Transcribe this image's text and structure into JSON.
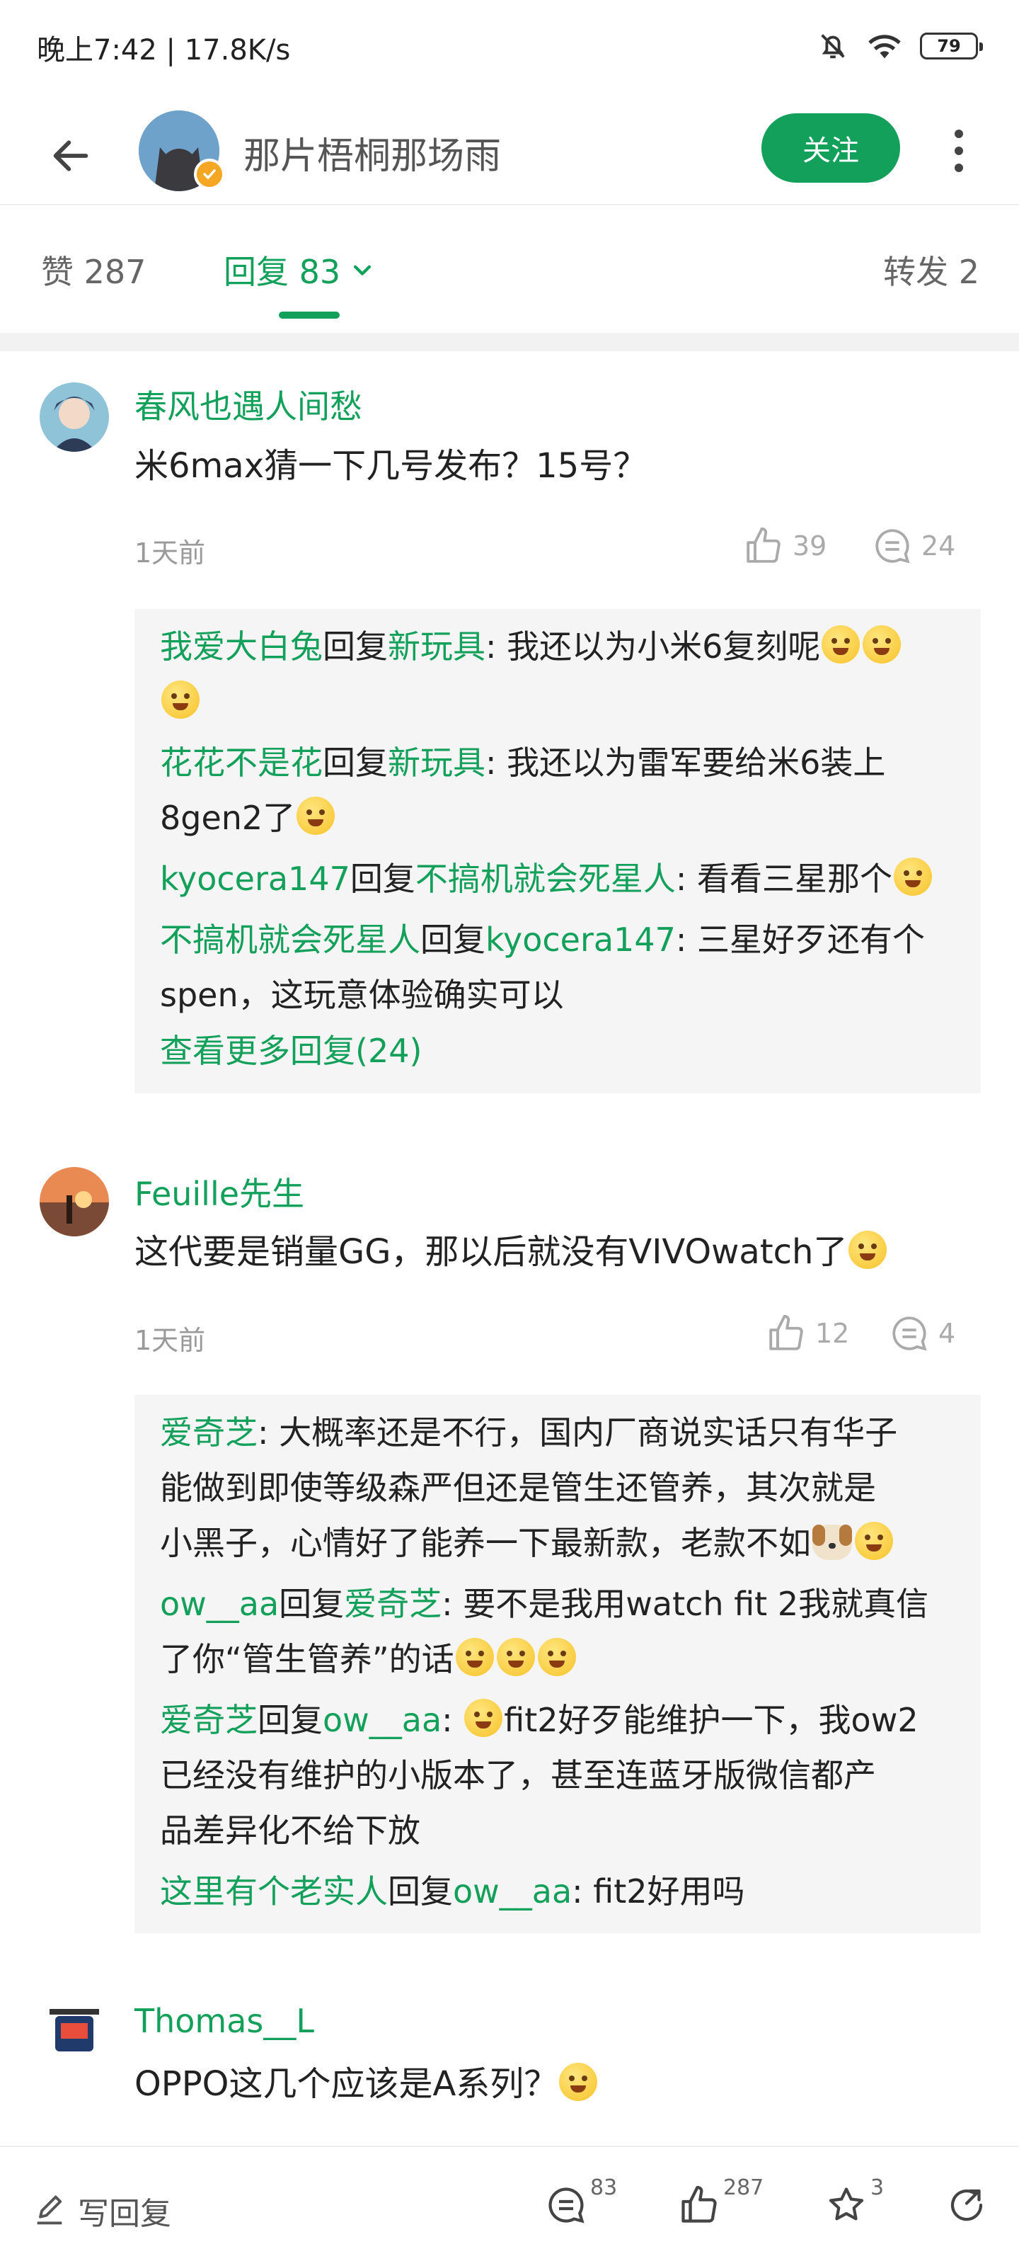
{
  "status": {
    "time_speed": "晚上7:42 | 17.8K/s",
    "battery": "79"
  },
  "header": {
    "title": "那片梧桐那场雨",
    "follow_label": "关注"
  },
  "tabs": {
    "likes": "赞 287",
    "replies": "回复 83",
    "forwards": "转发 2"
  },
  "comments": [
    {
      "author": "春风也遇人间愁",
      "text": "米6max猜一下几号发布？15号？",
      "time": "1天前",
      "likes": "39",
      "replies": "24",
      "sub_replies": [
        {
          "user": "我爱大白兔",
          "verb": "回复",
          "target": "新玩具",
          "text_1": ": 我还以为小米6复刻呢",
          "text_2": ""
        },
        {
          "user": "花花不是花",
          "verb": "回复",
          "target": "新玩具",
          "text_1": ": 我还以为雷军要给米6装上",
          "text_2": "8gen2了"
        },
        {
          "user": "kyocera147",
          "verb": "回复",
          "target": "不搞机就会死星人",
          "text_1": ": 看看三星那个",
          "text_2": ""
        },
        {
          "user": "不搞机就会死星人",
          "verb": "回复",
          "target": "kyocera147",
          "text_1": ": 三星好歹还有个",
          "text_2": "spen，这玩意体验确实可以"
        }
      ],
      "more_label": "查看更多回复(24)"
    },
    {
      "author": "Feuille先生",
      "text": "这代要是销量GG，那以后就没有VIVOwatch了",
      "time": "1天前",
      "likes": "12",
      "replies": "4",
      "sub_replies": [
        {
          "user": "爱奇芝",
          "verb": "",
          "target": "",
          "text_1": ": 大概率还是不行，国内厂商说实话只有华子",
          "text_2": "能做到即使等级森严但还是管生还管养，其次就是",
          "text_3": "小黑子，心情好了能养一下最新款，老款不如"
        },
        {
          "user": "ow__aa",
          "verb": "回复",
          "target": "爱奇芝",
          "text_1": ": 要不是我用watch fit 2我就真信",
          "text_2": "了你“管生管养”的话"
        },
        {
          "user": "爱奇芝",
          "verb": "回复",
          "target": "ow__aa",
          "text_1": ": ",
          "text_1b": "fit2好歹能维护一下，我ow2",
          "text_2": "已经没有维护的小版本了，甚至连蓝牙版微信都产",
          "text_3": "品差异化不给下放"
        },
        {
          "user": "这里有个老实人",
          "verb": "回复",
          "target": "ow__aa",
          "text_1": ": fit2好用吗"
        }
      ]
    },
    {
      "author": "Thomas__L",
      "text": "OPPO这几个应该是A系列？"
    }
  ],
  "bottom_bar": {
    "reply_placeholder": "写回复",
    "comment_count": "83",
    "like_count": "287",
    "star_count": "3"
  },
  "colors": {
    "accent": "#12a05a",
    "reply_bg": "#f5f5f5"
  }
}
